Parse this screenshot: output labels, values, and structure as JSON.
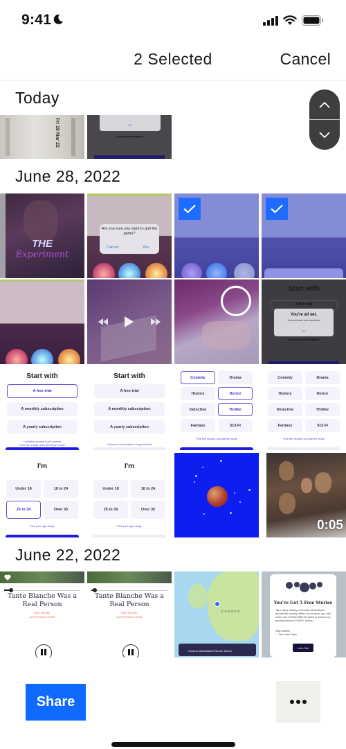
{
  "status_bar": {
    "time": "9:41",
    "icons": [
      "moon-icon",
      "cellular-signal-icon",
      "wifi-icon",
      "battery-icon"
    ]
  },
  "nav": {
    "title": "2 Selected",
    "cancel_label": "Cancel"
  },
  "sections": [
    {
      "title": "Today",
      "items": [
        {
          "kind": "photo",
          "description": "Printed label with dates",
          "text": [
            "Fri 18 Mar 22",
            "18 Mar 22"
          ],
          "selected": false
        },
        {
          "kind": "screenshot",
          "description": "Dark dialog with OK button",
          "text": [
            "OK",
            "A yearly subscription"
          ],
          "selected": false
        }
      ]
    },
    {
      "title": "June 28, 2022",
      "items": [
        {
          "kind": "photo",
          "description": "The Experiment poster",
          "text": [
            "THE",
            "Experiment"
          ],
          "selected": false
        },
        {
          "kind": "screenshot",
          "description": "Quit game dialog",
          "text": [
            "Are you sure you want to quit the game?",
            "Cancel",
            "Yes"
          ],
          "selected": false
        },
        {
          "kind": "photo",
          "description": "Drawing and colored lights",
          "selected": true
        },
        {
          "kind": "photo",
          "description": "Drawing and colored lights",
          "selected": true
        },
        {
          "kind": "photo",
          "description": "Drawing and colored lights",
          "selected": false
        },
        {
          "kind": "video",
          "description": "Video player with play controls",
          "selected": false
        },
        {
          "kind": "photo",
          "description": "Hand drawing with circle highlight",
          "selected": false
        },
        {
          "kind": "screenshot",
          "description": "Purchase success dialog",
          "text": [
            "Start with",
            "A free trial",
            "You're all set.",
            "Your purchase was successful",
            "OK",
            "A yearly subscription"
          ],
          "selected": false
        },
        {
          "kind": "screenshot",
          "title": "Start with",
          "options": [
            "A free trial",
            "A monthly subscription",
            "A yearly subscription"
          ],
          "selected_option": "A free trial",
          "note": [
            "Unlimited access to all content",
            "Free for 3 days, then $4.99 per week"
          ],
          "selected": false
        },
        {
          "kind": "screenshot",
          "title": "Start with",
          "options": [
            "A free trial",
            "A monthly subscription",
            "A yearly subscription"
          ],
          "selected_option": "",
          "note": [
            "Choose a subscription to get started"
          ],
          "selected": false
        },
        {
          "kind": "screenshot",
          "genres": [
            "Comedy",
            "Drama",
            "History",
            "Horror",
            "Detective",
            "Thriller",
            "Fantasy",
            "SCI-FI"
          ],
          "selected_genres": [
            "Comedy",
            "Horror",
            "Thriller"
          ],
          "note": [
            "Pick the movies you like the most"
          ],
          "selected": false
        },
        {
          "kind": "screenshot",
          "genres": [
            "Comedy",
            "Drama",
            "History",
            "Horror",
            "Detective",
            "Thriller",
            "Fantasy",
            "SCI-FI"
          ],
          "selected_genres": [],
          "note": [
            "Pick the movies you like the most"
          ],
          "selected": false
        },
        {
          "kind": "screenshot",
          "title": "I'm",
          "ages": [
            "Under 18",
            "18 to 24",
            "25 to 34",
            "Over 35"
          ],
          "selected_age": "25 to 34",
          "note": [
            "Pick your age range"
          ],
          "selected": false
        },
        {
          "kind": "screenshot",
          "title": "I'm",
          "ages": [
            "Under 18",
            "18 to 24",
            "25 to 34",
            "Over 35"
          ],
          "selected_age": "",
          "note": [
            "Pick your age range"
          ],
          "selected": false
        },
        {
          "kind": "image",
          "description": "Planet on blue background",
          "selected": false
        },
        {
          "kind": "video",
          "description": "Movie poster",
          "duration": "0:05",
          "selected": false
        }
      ]
    },
    {
      "title": "June 22, 2022",
      "items": [
        {
          "kind": "screenshot",
          "story_title": "Tante Blanche Was a Real Person",
          "meta": [
            "NATY MOORE",
            "AUTIO PRODUCTIONS"
          ],
          "selected": false
        },
        {
          "kind": "screenshot",
          "story_title": "Tante Blanche Was a Real Person",
          "meta": [
            "NATY MOORE",
            "AUTIO PRODUCTIONS"
          ],
          "selected": false
        },
        {
          "kind": "screenshot",
          "description": "Europe map",
          "map_label": "EUROPE",
          "footer": "Houlton: Blackhawk Putnam Tavern",
          "selected": false
        },
        {
          "kind": "screenshot",
          "title": "You've Got 5 Free Stories",
          "body": "Tap a story nearby, or browse destinations around the country. When you're done, you can select one of three different plans to access our growing library of 3,000+ stories.",
          "signoff": [
            "Safe travels!",
            "— The Autio Team"
          ],
          "button": "Let's Go!",
          "selected": false
        }
      ]
    }
  ],
  "scroll_control": {
    "up_icon": "chevron-up-icon",
    "down_icon": "chevron-down-icon"
  },
  "toolbar": {
    "share_label": "Share",
    "more_icon": "ellipsis-icon"
  },
  "colors": {
    "accent": "#0f6bff",
    "selection_overlay": "#465ae6",
    "scroll_control": "#3f3d3f",
    "more_button_bg": "#f1efec"
  }
}
